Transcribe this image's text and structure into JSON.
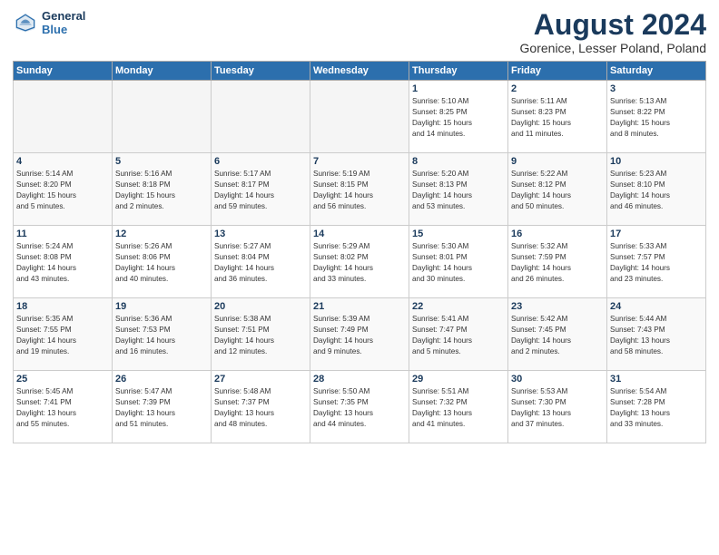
{
  "logo": {
    "line1": "General",
    "line2": "Blue"
  },
  "title": "August 2024",
  "subtitle": "Gorenice, Lesser Poland, Poland",
  "days_header": [
    "Sunday",
    "Monday",
    "Tuesday",
    "Wednesday",
    "Thursday",
    "Friday",
    "Saturday"
  ],
  "weeks": [
    [
      {
        "num": "",
        "info": ""
      },
      {
        "num": "",
        "info": ""
      },
      {
        "num": "",
        "info": ""
      },
      {
        "num": "",
        "info": ""
      },
      {
        "num": "1",
        "info": "Sunrise: 5:10 AM\nSunset: 8:25 PM\nDaylight: 15 hours\nand 14 minutes."
      },
      {
        "num": "2",
        "info": "Sunrise: 5:11 AM\nSunset: 8:23 PM\nDaylight: 15 hours\nand 11 minutes."
      },
      {
        "num": "3",
        "info": "Sunrise: 5:13 AM\nSunset: 8:22 PM\nDaylight: 15 hours\nand 8 minutes."
      }
    ],
    [
      {
        "num": "4",
        "info": "Sunrise: 5:14 AM\nSunset: 8:20 PM\nDaylight: 15 hours\nand 5 minutes."
      },
      {
        "num": "5",
        "info": "Sunrise: 5:16 AM\nSunset: 8:18 PM\nDaylight: 15 hours\nand 2 minutes."
      },
      {
        "num": "6",
        "info": "Sunrise: 5:17 AM\nSunset: 8:17 PM\nDaylight: 14 hours\nand 59 minutes."
      },
      {
        "num": "7",
        "info": "Sunrise: 5:19 AM\nSunset: 8:15 PM\nDaylight: 14 hours\nand 56 minutes."
      },
      {
        "num": "8",
        "info": "Sunrise: 5:20 AM\nSunset: 8:13 PM\nDaylight: 14 hours\nand 53 minutes."
      },
      {
        "num": "9",
        "info": "Sunrise: 5:22 AM\nSunset: 8:12 PM\nDaylight: 14 hours\nand 50 minutes."
      },
      {
        "num": "10",
        "info": "Sunrise: 5:23 AM\nSunset: 8:10 PM\nDaylight: 14 hours\nand 46 minutes."
      }
    ],
    [
      {
        "num": "11",
        "info": "Sunrise: 5:24 AM\nSunset: 8:08 PM\nDaylight: 14 hours\nand 43 minutes."
      },
      {
        "num": "12",
        "info": "Sunrise: 5:26 AM\nSunset: 8:06 PM\nDaylight: 14 hours\nand 40 minutes."
      },
      {
        "num": "13",
        "info": "Sunrise: 5:27 AM\nSunset: 8:04 PM\nDaylight: 14 hours\nand 36 minutes."
      },
      {
        "num": "14",
        "info": "Sunrise: 5:29 AM\nSunset: 8:02 PM\nDaylight: 14 hours\nand 33 minutes."
      },
      {
        "num": "15",
        "info": "Sunrise: 5:30 AM\nSunset: 8:01 PM\nDaylight: 14 hours\nand 30 minutes."
      },
      {
        "num": "16",
        "info": "Sunrise: 5:32 AM\nSunset: 7:59 PM\nDaylight: 14 hours\nand 26 minutes."
      },
      {
        "num": "17",
        "info": "Sunrise: 5:33 AM\nSunset: 7:57 PM\nDaylight: 14 hours\nand 23 minutes."
      }
    ],
    [
      {
        "num": "18",
        "info": "Sunrise: 5:35 AM\nSunset: 7:55 PM\nDaylight: 14 hours\nand 19 minutes."
      },
      {
        "num": "19",
        "info": "Sunrise: 5:36 AM\nSunset: 7:53 PM\nDaylight: 14 hours\nand 16 minutes."
      },
      {
        "num": "20",
        "info": "Sunrise: 5:38 AM\nSunset: 7:51 PM\nDaylight: 14 hours\nand 12 minutes."
      },
      {
        "num": "21",
        "info": "Sunrise: 5:39 AM\nSunset: 7:49 PM\nDaylight: 14 hours\nand 9 minutes."
      },
      {
        "num": "22",
        "info": "Sunrise: 5:41 AM\nSunset: 7:47 PM\nDaylight: 14 hours\nand 5 minutes."
      },
      {
        "num": "23",
        "info": "Sunrise: 5:42 AM\nSunset: 7:45 PM\nDaylight: 14 hours\nand 2 minutes."
      },
      {
        "num": "24",
        "info": "Sunrise: 5:44 AM\nSunset: 7:43 PM\nDaylight: 13 hours\nand 58 minutes."
      }
    ],
    [
      {
        "num": "25",
        "info": "Sunrise: 5:45 AM\nSunset: 7:41 PM\nDaylight: 13 hours\nand 55 minutes."
      },
      {
        "num": "26",
        "info": "Sunrise: 5:47 AM\nSunset: 7:39 PM\nDaylight: 13 hours\nand 51 minutes."
      },
      {
        "num": "27",
        "info": "Sunrise: 5:48 AM\nSunset: 7:37 PM\nDaylight: 13 hours\nand 48 minutes."
      },
      {
        "num": "28",
        "info": "Sunrise: 5:50 AM\nSunset: 7:35 PM\nDaylight: 13 hours\nand 44 minutes."
      },
      {
        "num": "29",
        "info": "Sunrise: 5:51 AM\nSunset: 7:32 PM\nDaylight: 13 hours\nand 41 minutes."
      },
      {
        "num": "30",
        "info": "Sunrise: 5:53 AM\nSunset: 7:30 PM\nDaylight: 13 hours\nand 37 minutes."
      },
      {
        "num": "31",
        "info": "Sunrise: 5:54 AM\nSunset: 7:28 PM\nDaylight: 13 hours\nand 33 minutes."
      }
    ]
  ]
}
